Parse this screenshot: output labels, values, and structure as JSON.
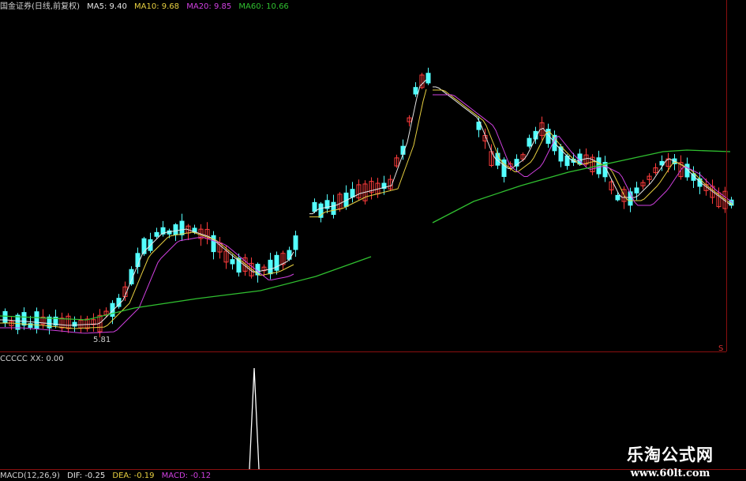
{
  "top_info": {
    "name": "国金证券(日线,前复权)",
    "ma5": "MA5: 9.40",
    "ma10": "MA10: 9.68",
    "ma20": "MA20: 9.85",
    "ma60": "MA60: 10.66"
  },
  "mid_info": {
    "indicator": "CCCCC XX: 0.00"
  },
  "bottom_info": {
    "macd": "MACD(12,26,9)",
    "dif": "DIF: -0.25",
    "dea": "DEA: -0.19",
    "macd_val": "MACD: -0.12"
  },
  "low_label": "5.81",
  "marker": "S",
  "watermark": {
    "title": "乐淘公式网",
    "url": "www.60lt.com"
  },
  "colors": {
    "bg": "#000000",
    "up": "#ff3c3c",
    "down": "#54ffff",
    "ma5": "#e6e6e6",
    "ma10": "#e8d040",
    "ma20": "#d040e0",
    "ma60": "#30c030",
    "grid": "#8a0f0f",
    "spike": "#ffffff"
  },
  "chart_data": {
    "type": "candlestick",
    "series": [
      {
        "name": "MA5",
        "value": 9.4
      },
      {
        "name": "MA10",
        "value": 9.68
      },
      {
        "name": "MA20",
        "value": 9.85
      },
      {
        "name": "MA60",
        "value": 10.66
      }
    ],
    "indicator": {
      "name": "XX",
      "value": 0.0
    },
    "macd": {
      "dif": -0.25,
      "dea": -0.19,
      "macd": -0.12
    },
    "low_marker": 5.81
  }
}
